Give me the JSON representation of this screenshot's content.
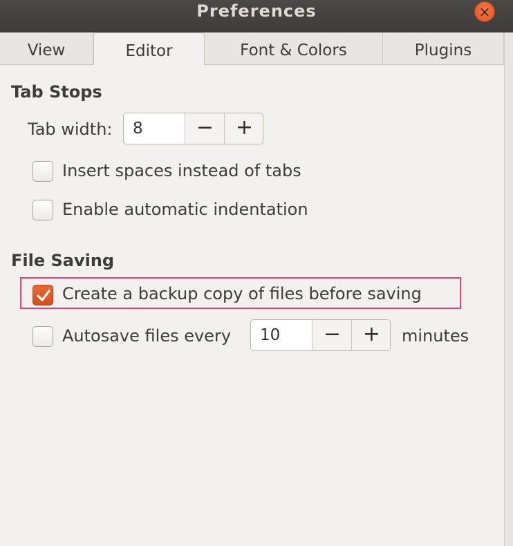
{
  "window": {
    "title": "Preferences",
    "close_icon": "close-icon"
  },
  "tabs": [
    {
      "label": "View"
    },
    {
      "label": "Editor"
    },
    {
      "label": "Font & Colors"
    },
    {
      "label": "Plugins"
    }
  ],
  "active_tab": "Editor",
  "tab_stops": {
    "heading": "Tab Stops",
    "tab_width_label": "Tab width:",
    "tab_width_value": "8",
    "insert_spaces": {
      "label": "Insert spaces instead of tabs",
      "checked": false
    },
    "auto_indent": {
      "label": "Enable automatic indentation",
      "checked": false
    }
  },
  "file_saving": {
    "heading": "File Saving",
    "backup": {
      "label": "Create a backup copy of files before saving",
      "checked": true
    },
    "autosave": {
      "label": "Autosave files every",
      "checked": false,
      "value": "10",
      "unit": "minutes"
    }
  },
  "spin_buttons": {
    "minus": "−",
    "plus": "+"
  },
  "colors": {
    "accent": "#e1531d",
    "highlight": "#e2457a",
    "titlebar": "#3d3c3a"
  }
}
